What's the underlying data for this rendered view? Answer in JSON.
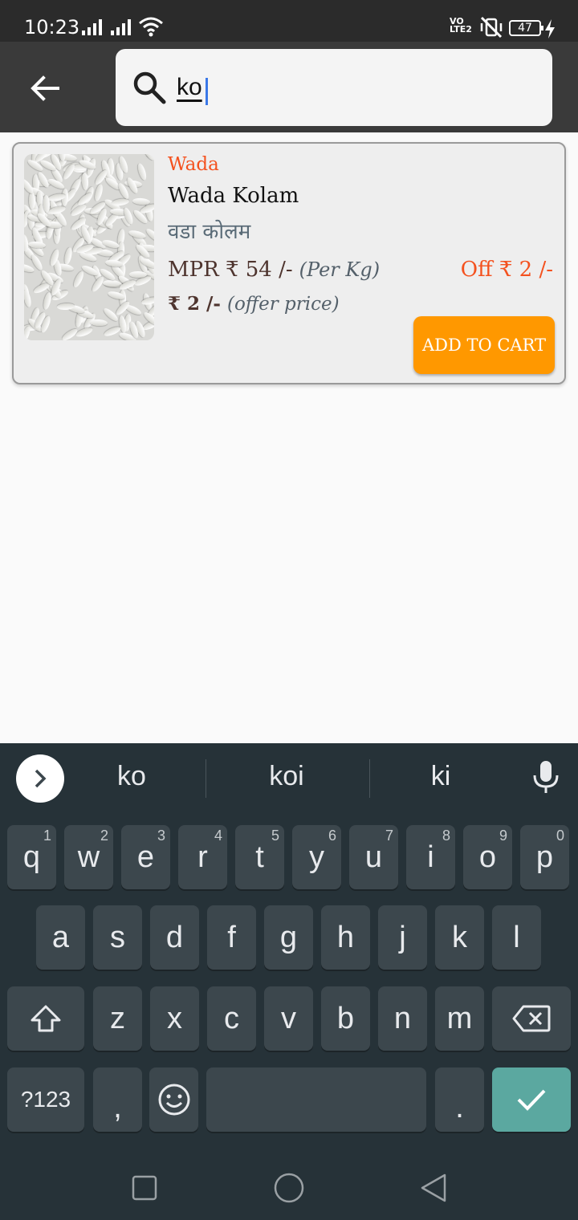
{
  "status": {
    "time": "10:23",
    "battery": "47",
    "volte": "VO LTE2"
  },
  "search": {
    "query": "ko"
  },
  "product": {
    "brand": "Wada",
    "name": "Wada Kolam",
    "name_hindi": "वडा कोलम",
    "mrp": "MPR ₹ 54 /-",
    "unit": "(Per Kg)",
    "off": "Off ₹ 2 /-",
    "offer_price": "₹ 2 /-",
    "offer_label": "(offer price)",
    "add_to_cart": "ADD TO CART"
  },
  "keyboard": {
    "suggestions": [
      "ko",
      "koi",
      "ki"
    ],
    "row1": [
      {
        "k": "q",
        "h": "1"
      },
      {
        "k": "w",
        "h": "2"
      },
      {
        "k": "e",
        "h": "3"
      },
      {
        "k": "r",
        "h": "4"
      },
      {
        "k": "t",
        "h": "5"
      },
      {
        "k": "y",
        "h": "6"
      },
      {
        "k": "u",
        "h": "7"
      },
      {
        "k": "i",
        "h": "8"
      },
      {
        "k": "o",
        "h": "9"
      },
      {
        "k": "p",
        "h": "0"
      }
    ],
    "row2": [
      "a",
      "s",
      "d",
      "f",
      "g",
      "h",
      "j",
      "k",
      "l"
    ],
    "row3": [
      "z",
      "x",
      "c",
      "v",
      "b",
      "n",
      "m"
    ],
    "symbols_label": "?123",
    "comma": ",",
    "period": "."
  }
}
